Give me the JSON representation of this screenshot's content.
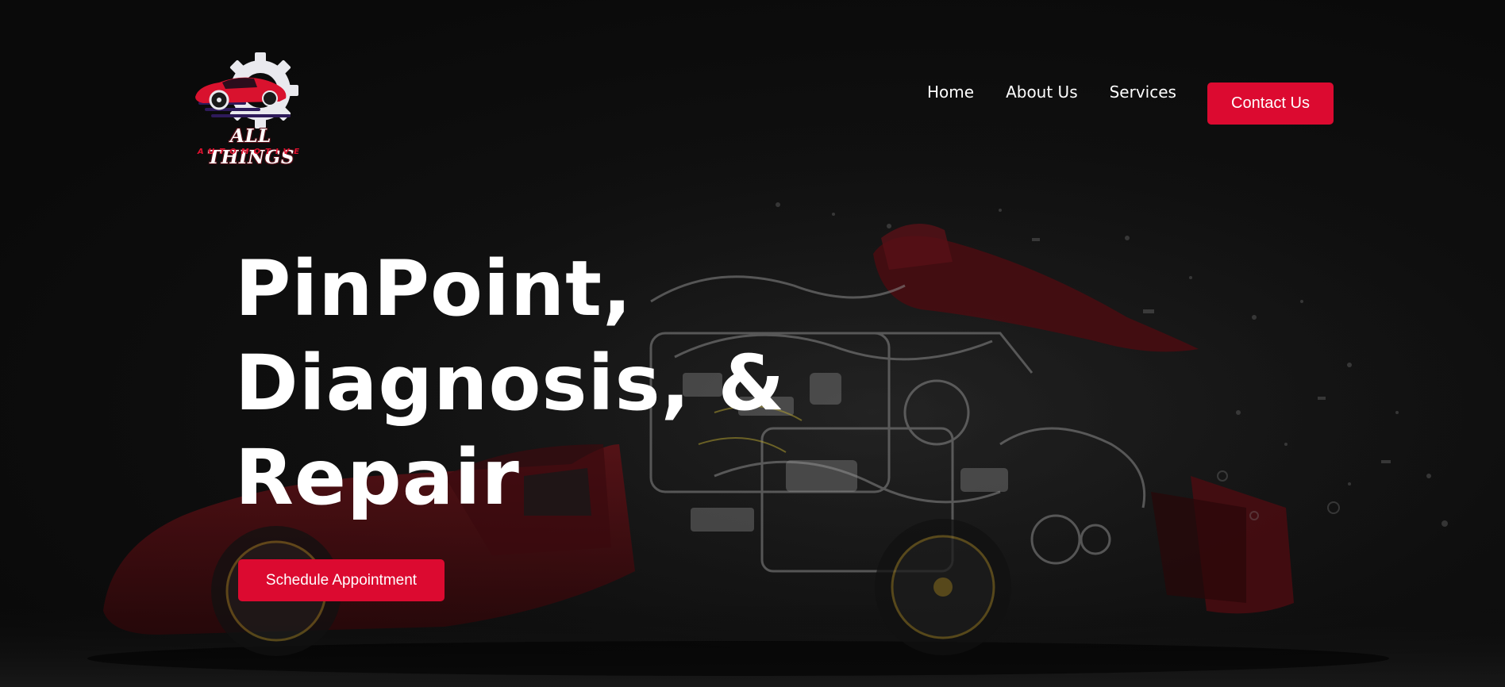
{
  "brand": {
    "name": "ALL THINGS",
    "tagline": "AUTOMOTIVE",
    "logo_icon": "gear-car-logo",
    "colors": {
      "accent": "#dc0a30",
      "background": "#0b0b0b",
      "text": "#ffffff"
    }
  },
  "nav": {
    "items": [
      {
        "label": "Home"
      },
      {
        "label": "About Us"
      },
      {
        "label": "Services"
      }
    ],
    "cta_label": "Contact Us"
  },
  "hero": {
    "headline_lines": [
      "PinPoint,",
      "Diagnosis, &",
      "Repair"
    ],
    "cta_label": "Schedule Appointment",
    "background_image": "exploded-sports-car-engine"
  }
}
